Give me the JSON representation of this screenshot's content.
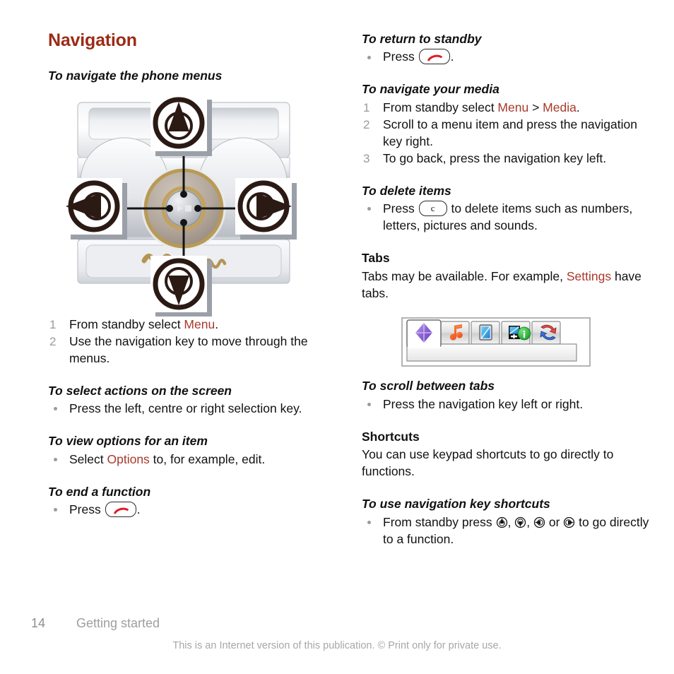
{
  "page": {
    "heading": "Navigation",
    "footer": {
      "page_number": "14",
      "chapter": "Getting started",
      "note": "This is an Internet version of this publication. © Print only for private use."
    },
    "colors": {
      "heading": "#9c2b16",
      "reference": "#a8392a",
      "body": "#111111",
      "muted": "#9b9b9b"
    }
  },
  "left_column": {
    "task1": {
      "title": "To navigate the phone menus",
      "steps": [
        {
          "num": "1",
          "text_before": "From standby select ",
          "ref": "Menu",
          "text_after": "."
        },
        {
          "num": "2",
          "text_before": "Use the navigation key to move through the menus.",
          "ref": "",
          "text_after": ""
        }
      ]
    },
    "figure": {
      "name": "phone-navigation-key-diagram",
      "callouts": [
        "navigation-key-up",
        "navigation-key-left",
        "navigation-key-right",
        "navigation-key-down"
      ],
      "centre_key": "play-stop-centre-key",
      "brand_mark": "walkman-logo"
    },
    "task2": {
      "title": "To select actions on the screen",
      "bullets": [
        {
          "text_before": "Press the left, centre or right selection key.",
          "ref": "",
          "text_after": ""
        }
      ]
    },
    "task3": {
      "title": "To view options for an item",
      "bullets": [
        {
          "text_before": "Select ",
          "ref": "Options",
          "text_after": " to, for example, edit."
        }
      ]
    },
    "task4": {
      "title": "To end a function",
      "bullets": [
        {
          "text_before": "Press ",
          "key": "end-call-key",
          "text_after": "."
        }
      ]
    }
  },
  "right_column": {
    "task1": {
      "title": "To return to standby",
      "bullets": [
        {
          "text_before": "Press ",
          "key": "end-call-key",
          "text_after": "."
        }
      ]
    },
    "task2": {
      "title": "To navigate your media",
      "steps": [
        {
          "num": "1",
          "parts": [
            "From standby select ",
            "Menu",
            " > ",
            "Media",
            "."
          ]
        },
        {
          "num": "2",
          "parts": [
            "Scroll to a menu item and press the navigation key right.",
            "",
            "",
            "",
            ""
          ]
        },
        {
          "num": "3",
          "parts": [
            "To go back, press the navigation key left.",
            "",
            "",
            "",
            ""
          ]
        }
      ]
    },
    "task3": {
      "title": "To delete items",
      "bullets": [
        {
          "text_before": "Press ",
          "key": "c-clear-key",
          "text_after": " to delete items such as numbers, letters, pictures and sounds."
        }
      ]
    },
    "tabs_section": {
      "title": "Tabs",
      "text_before": "Tabs may be available. For example, ",
      "ref": "Settings",
      "text_after": " have tabs."
    },
    "tabs_figure": {
      "name": "tabs-strip-screenshot",
      "tabs": [
        {
          "icon": "purple-diamond-icon",
          "active": true
        },
        {
          "icon": "music-note-icon",
          "active": false
        },
        {
          "icon": "picture-icon",
          "active": false
        },
        {
          "icon": "picture-info-icon",
          "active": false
        },
        {
          "icon": "update-sync-icon",
          "active": false
        }
      ]
    },
    "task4": {
      "title": "To scroll between tabs",
      "bullets": [
        {
          "text_before": "Press the navigation key left or right.",
          "ref": "",
          "text_after": ""
        }
      ]
    },
    "shortcuts_section": {
      "title": "Shortcuts",
      "text": "You can use keypad shortcuts to go directly to functions."
    },
    "task5": {
      "title": "To use navigation key shortcuts",
      "bullet": {
        "text_before": "From standby press ",
        "sep1": ", ",
        "sep2": ", ",
        "sep3": " or ",
        "text_after": " to go directly to a function."
      }
    }
  }
}
